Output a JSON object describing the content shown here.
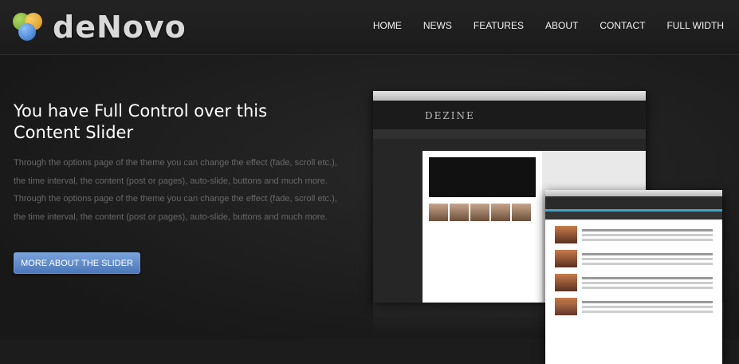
{
  "header": {
    "logo_text": "deNovo",
    "nav": [
      "HOME",
      "NEWS",
      "FEATURES",
      "ABOUT",
      "CONTACT",
      "FULL WIDTH"
    ]
  },
  "slide": {
    "title": "You have Full Control over this Content Slider",
    "description": "Through the options page of the theme you can change the effect (fade, scroll etc.), the time interval, the content (post or pages), auto-slide, buttons and much more. Through the options page of the theme you can change the effect (fade, scroll etc.), the time interval, the content (post or pages), auto-slide, buttons and much more.",
    "button_label": "MORE ABOUT THE SLIDER"
  },
  "colors": {
    "background": "#1c1c1c",
    "button": "#5b86c6",
    "description_text": "#686868"
  }
}
